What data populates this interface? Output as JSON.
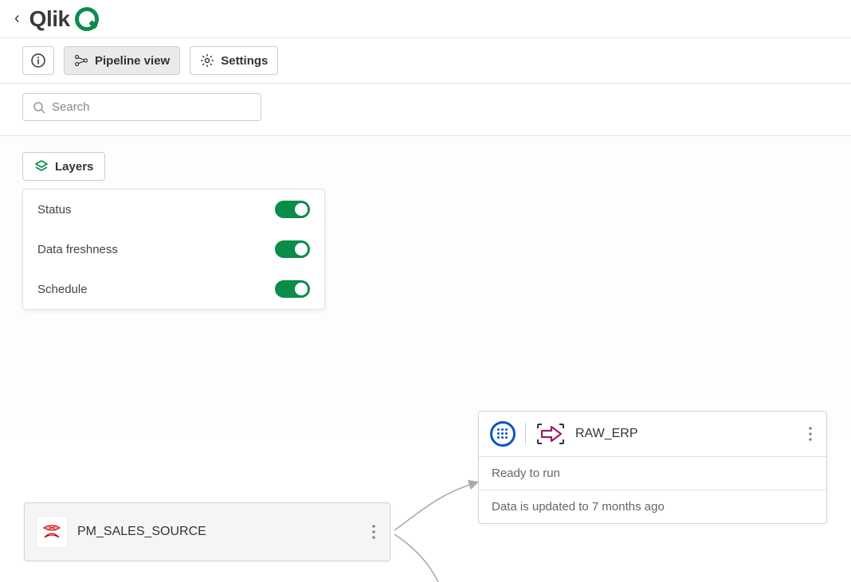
{
  "header": {
    "brand": "Qlik"
  },
  "toolbar": {
    "pipeline_view_label": "Pipeline view",
    "settings_label": "Settings"
  },
  "search": {
    "placeholder": "Search"
  },
  "layers": {
    "button_label": "Layers",
    "items": [
      {
        "label": "Status",
        "on": true
      },
      {
        "label": "Data freshness",
        "on": true
      },
      {
        "label": "Schedule",
        "on": true
      }
    ]
  },
  "nodes": {
    "source": {
      "title": "PM_SALES_SOURCE"
    },
    "target": {
      "title": "RAW_ERP",
      "status": "Ready to run",
      "freshness": "Data is updated to 7 months ago"
    }
  }
}
